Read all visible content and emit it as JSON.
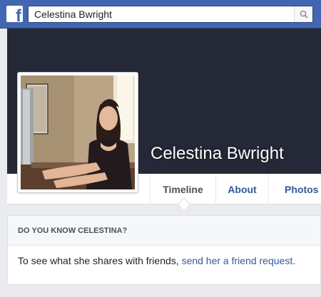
{
  "topbar": {
    "logo_icon": "facebook-f-icon",
    "logo_letter": "f",
    "search": {
      "value": "Celestina Bwright",
      "placeholder": "Search"
    },
    "search_icon": "search-icon"
  },
  "profile": {
    "name": "Celestina Bwright",
    "photo_icon": "profile-photo"
  },
  "tabs": [
    {
      "label": "Timeline",
      "active": true
    },
    {
      "label": "About",
      "active": false
    },
    {
      "label": "Photos",
      "active": false
    }
  ],
  "card": {
    "header": "DO YOU KNOW CELESTINA?",
    "body_text": "To see what she shares with friends, ",
    "link_text": "send her a friend request."
  },
  "colors": {
    "brand_blue": "#4267b2",
    "cover_dark": "#252836",
    "link_blue": "#365899",
    "page_bg": "#e9ebee"
  }
}
